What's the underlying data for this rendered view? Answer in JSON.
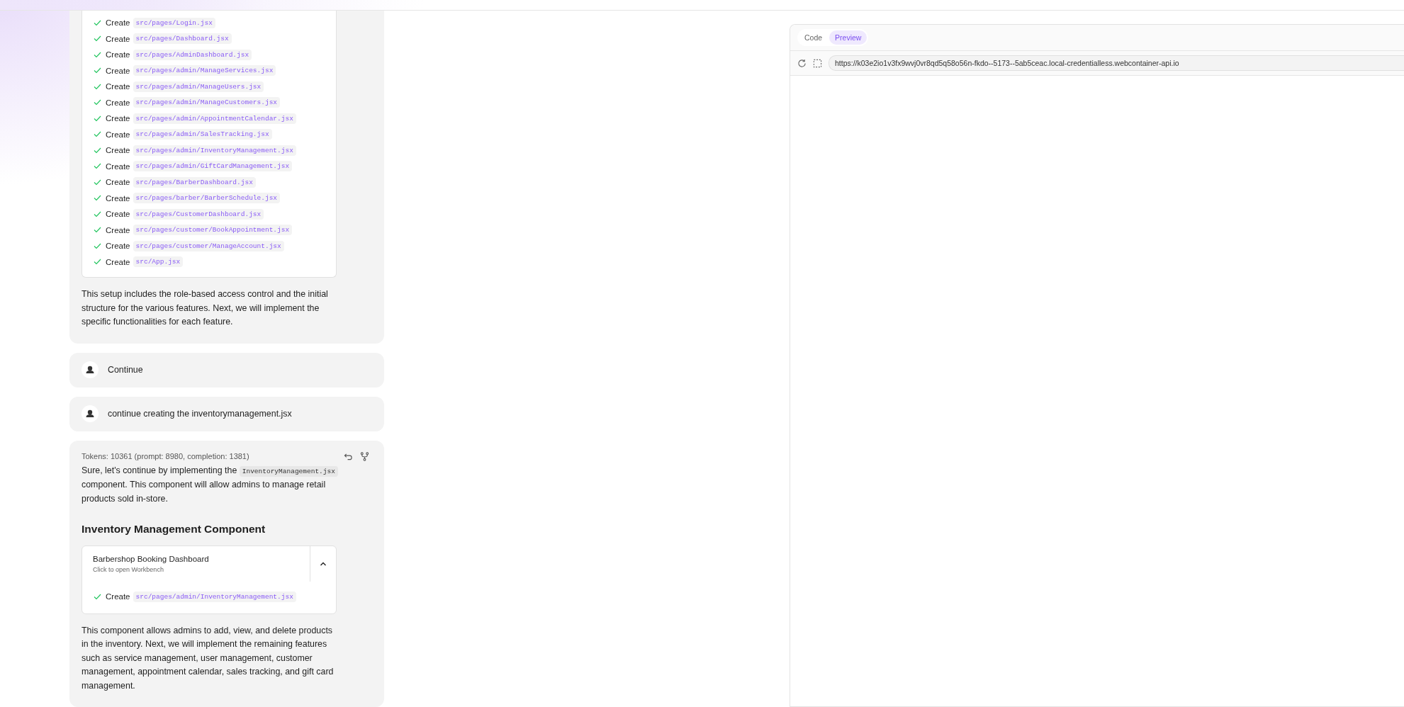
{
  "chat": {
    "messages": [
      {
        "kind": "assistant",
        "actions": [
          {
            "verb": "Create",
            "path": "src/pages/Login.jsx",
            "done": true
          },
          {
            "verb": "Create",
            "path": "src/pages/Dashboard.jsx",
            "done": true
          },
          {
            "verb": "Create",
            "path": "src/pages/AdminDashboard.jsx",
            "done": true
          },
          {
            "verb": "Create",
            "path": "src/pages/admin/ManageServices.jsx",
            "done": true
          },
          {
            "verb": "Create",
            "path": "src/pages/admin/ManageUsers.jsx",
            "done": true
          },
          {
            "verb": "Create",
            "path": "src/pages/admin/ManageCustomers.jsx",
            "done": true
          },
          {
            "verb": "Create",
            "path": "src/pages/admin/AppointmentCalendar.jsx",
            "done": true
          },
          {
            "verb": "Create",
            "path": "src/pages/admin/SalesTracking.jsx",
            "done": true
          },
          {
            "verb": "Create",
            "path": "src/pages/admin/InventoryManagement.jsx",
            "done": true
          },
          {
            "verb": "Create",
            "path": "src/pages/admin/GiftCardManagement.jsx",
            "done": true
          },
          {
            "verb": "Create",
            "path": "src/pages/BarberDashboard.jsx",
            "done": true
          },
          {
            "verb": "Create",
            "path": "src/pages/barber/BarberSchedule.jsx",
            "done": true
          },
          {
            "verb": "Create",
            "path": "src/pages/CustomerDashboard.jsx",
            "done": true
          },
          {
            "verb": "Create",
            "path": "src/pages/customer/BookAppointment.jsx",
            "done": true
          },
          {
            "verb": "Create",
            "path": "src/pages/customer/ManageAccount.jsx",
            "done": true
          },
          {
            "verb": "Create",
            "path": "src/App.jsx",
            "done": true
          }
        ],
        "text": "This setup includes the role-based access control and the initial structure for the various features. Next, we will implement the specific functionalities for each feature."
      },
      {
        "kind": "user",
        "text": "Continue"
      },
      {
        "kind": "user",
        "text": "continue creating the inventorymanagement.jsx"
      },
      {
        "kind": "assistant",
        "tokens": "Tokens: 10361 (prompt: 8980, completion: 1381)",
        "intro": {
          "before": "Sure, let's continue by implementing the",
          "code": "InventoryManagement.jsx",
          "after": "component. This component will allow admins to manage retail products sold in-store."
        },
        "heading": "Inventory Management Component",
        "artifact": {
          "title": "Barbershop Booking Dashboard",
          "subtitle": "Click to open Workbench",
          "expanded": true,
          "actions": [
            {
              "verb": "Create",
              "path": "src/pages/admin/InventoryManagement.jsx",
              "done": true
            }
          ]
        },
        "text": "This component allows admins to add, view, and delete products in the inventory. Next, we will implement the remaining features such as service management, user management, customer management, appointment calendar, sales tracking, and gift card management."
      }
    ]
  },
  "preview": {
    "tabs": [
      {
        "label": "Code",
        "selected": false
      },
      {
        "label": "Preview",
        "selected": true
      }
    ],
    "url": "https://k03e2io1v3fx9wvj0vr8qd5q58o56n-fkdo--5173--5ab5ceac.local-credentialless.webcontainer-api.io"
  }
}
